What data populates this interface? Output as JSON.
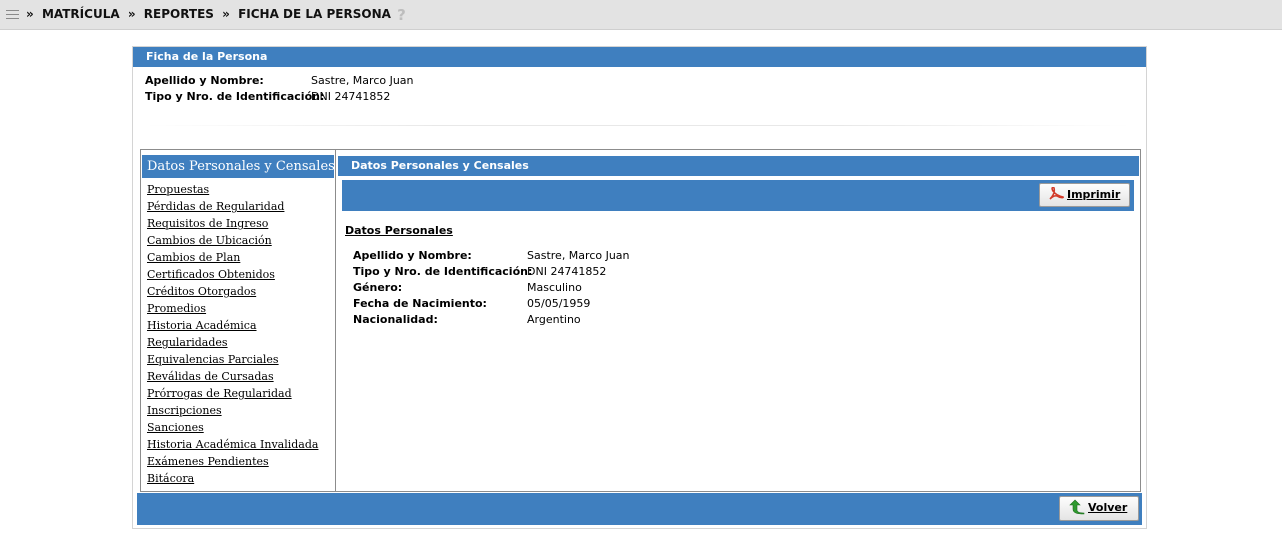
{
  "breadcrumb": {
    "separator": "»",
    "items": [
      "MATRÍCULA",
      "REPORTES",
      "FICHA DE LA PERSONA"
    ],
    "help_glyph": "?"
  },
  "panel": {
    "title": "Ficha de la Persona",
    "name_label": "Apellido y Nombre:",
    "name_value": "Sastre, Marco Juan",
    "id_label": "Tipo y Nro. de Identificación:",
    "id_value": "DNI 24741852"
  },
  "sidebar": {
    "active": "Datos Personales y Censales",
    "items": [
      "Propuestas",
      "Pérdidas de Regularidad",
      "Requisitos de Ingreso",
      "Cambios de Ubicación",
      "Cambios de Plan",
      "Certificados Obtenidos",
      "Créditos Otorgados",
      "Promedios",
      "Historia Académica",
      "Regularidades",
      "Equivalencias Parciales",
      "Reválidas de Cursadas",
      "Prórrogas de Regularidad",
      "Inscripciones",
      "Sanciones",
      "Historia Académica Invalidada",
      "Exámenes Pendientes",
      "Bitácora"
    ]
  },
  "content": {
    "title": "Datos Personales y Censales",
    "print_label": "Imprimir",
    "section_title": "Datos Personales",
    "fields": [
      {
        "label": "Apellido y Nombre:",
        "value": "Sastre, Marco Juan"
      },
      {
        "label": "Tipo y Nro. de Identificación:",
        "value": "DNI 24741852"
      },
      {
        "label": "Género:",
        "value": "Masculino"
      },
      {
        "label": "Fecha de Nacimiento:",
        "value": "05/05/1959"
      },
      {
        "label": "Nacionalidad:",
        "value": "Argentino"
      }
    ]
  },
  "footer": {
    "back_label": "Volver"
  },
  "icons": {
    "menu": "menu-icon",
    "help": "help-icon",
    "print": "pdf-icon",
    "back": "back-arrow-icon"
  },
  "colors": {
    "header_blue": "#3f7fbf",
    "topbar_gray": "#e3e3e3",
    "pdf_red": "#d23b2a",
    "back_green": "#2f9a2f"
  }
}
